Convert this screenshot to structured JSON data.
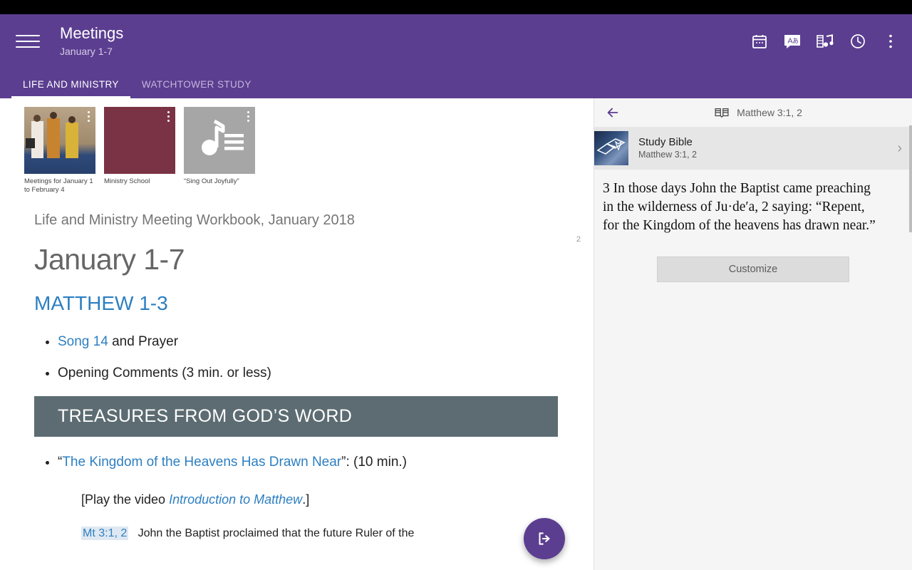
{
  "appbar": {
    "menu_icon": "hamburger-icon",
    "title": "Meetings",
    "subtitle": "January 1-7",
    "icons": [
      {
        "name": "calendar-icon",
        "label": "Calendar"
      },
      {
        "name": "language-icon",
        "label": "Language"
      },
      {
        "name": "media-icon",
        "label": "Media"
      },
      {
        "name": "history-icon",
        "label": "History"
      },
      {
        "name": "overflow-menu-icon",
        "label": "More options"
      }
    ]
  },
  "tabs": [
    {
      "label": "LIFE AND MINISTRY",
      "active": true
    },
    {
      "label": "WATCHTOWER STUDY",
      "active": false
    }
  ],
  "thumbnails": [
    {
      "caption": "Meetings for January 1 to February 4",
      "name": "thumb-meetings"
    },
    {
      "caption": "Ministry School",
      "name": "thumb-ministry-school"
    },
    {
      "caption": "“Sing Out Joyfully”",
      "name": "thumb-sing-out-joyfully"
    }
  ],
  "document": {
    "page_number": "2",
    "publication": "Life and Ministry Meeting Workbook, January 2018",
    "date_heading": "January 1-7",
    "scripture_reference": "MATTHEW 1-3",
    "opening_items": [
      {
        "link": "Song 14",
        "rest": " and Prayer"
      },
      {
        "link": "",
        "rest": "Opening Comments (3 min. or less)"
      }
    ],
    "section_heading": "TREASURES FROM GOD’S WORD",
    "treasure_item": {
      "quote_open": "“",
      "link": "The Kingdom of the Heavens Has Drawn Near",
      "rest": "”: (10 min.)"
    },
    "video_note": {
      "pre": "[Play the video ",
      "title": "Introduction to Matthew",
      "post": ".]"
    },
    "cut_line": {
      "verse_ref": "Mt 3:1, 2",
      "text": "John the Baptist proclaimed that the future Ruler of the"
    },
    "fab_name": "open-external-fab"
  },
  "sidepanel": {
    "back_icon": "back-arrow-icon",
    "book_icon": "open-book-icon",
    "header_label": "Matthew 3:1, 2",
    "publication_card": {
      "title": "Study Bible",
      "subtitle": "Matthew 3:1, 2",
      "chevron": "›"
    },
    "scripture_text": "3  In those days John the Baptist came preaching in the wilderness of Ju·de′a, 2 saying: “Repent, for the Kingdom of the heavens has drawn near.”",
    "customize_label": "Customize"
  },
  "colors": {
    "appbar_purple": "#5B3E90",
    "link_blue": "#2D7FC1",
    "section_bar": "#5C6C72",
    "thumb_maroon": "#7A3345",
    "thumb_gray": "#A6A6A6"
  }
}
